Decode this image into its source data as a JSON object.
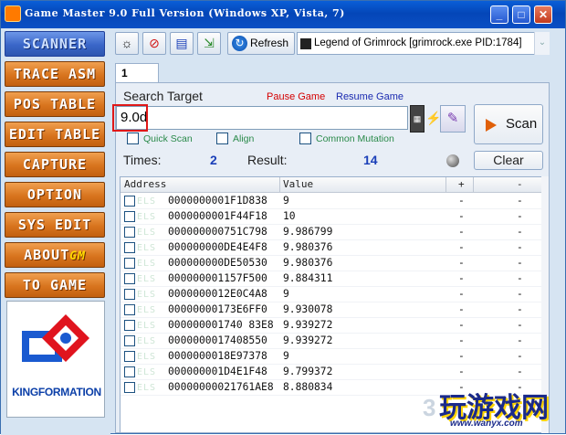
{
  "window": {
    "title": "Game Master 9.0 Full Version (Windows XP, Vista, 7)",
    "minimize": "_",
    "maximize": "□",
    "close": "✕"
  },
  "sidebar": {
    "items": [
      {
        "label": "SCANNER",
        "active": true
      },
      {
        "label": "TRACE ASM"
      },
      {
        "label": "POS TABLE"
      },
      {
        "label": "EDIT TABLE"
      },
      {
        "label": "CAPTURE"
      },
      {
        "label": "OPTION"
      },
      {
        "label": "SYS EDIT"
      },
      {
        "label": "ABOUT",
        "suffix": "GM"
      },
      {
        "label": "TO GAME"
      }
    ],
    "logo_text": "KINGFORMATION"
  },
  "toolbar": {
    "icons": [
      "sun-icon",
      "cancel-icon",
      "document-icon",
      "export-icon"
    ],
    "refresh_label": "Refresh",
    "process": "Legend of Grimrock  [grimrock.exe PID:1784]"
  },
  "tab": {
    "label": "1"
  },
  "search": {
    "label": "Search Target",
    "pause": "Pause Game",
    "resume": "Resume Game",
    "value": "9.0d",
    "scan_label": "Scan",
    "options": [
      "Quick Scan",
      "Align",
      "Common Mutation"
    ]
  },
  "stats": {
    "times_label": "Times:",
    "times_value": "2",
    "result_label": "Result:",
    "result_value": "14",
    "clear_label": "Clear"
  },
  "grid": {
    "columns": {
      "address": "Address",
      "value": "Value",
      "plus": "+",
      "minus": "-"
    },
    "rows": [
      {
        "address": "0000000001F1D838",
        "value": "9",
        "plus": "-",
        "minus": "-"
      },
      {
        "address": "0000000001F44F18",
        "value": "10",
        "plus": "-",
        "minus": "-"
      },
      {
        "address": "000000000751C798",
        "value": "9.986799",
        "plus": "-",
        "minus": "-"
      },
      {
        "address": "000000000DE4E4F8",
        "value": "9.980376",
        "plus": "-",
        "minus": "-"
      },
      {
        "address": "000000000DE50530",
        "value": "9.980376",
        "plus": "-",
        "minus": "-"
      },
      {
        "address": "000000001157F500",
        "value": "9.884311",
        "plus": "-",
        "minus": "-"
      },
      {
        "address": "0000000012E0C4A8",
        "value": "9",
        "plus": "-",
        "minus": "-"
      },
      {
        "address": "00000000173E6FF0",
        "value": "9.930078",
        "plus": "-",
        "minus": "-"
      },
      {
        "address": "000000001740 83E8",
        "value": "9.939272",
        "plus": "-",
        "minus": "-"
      },
      {
        "address": "0000000017408550",
        "value": "9.939272",
        "plus": "-",
        "minus": "-"
      },
      {
        "address": "0000000018E97378",
        "value": "9",
        "plus": "-",
        "minus": "-"
      },
      {
        "address": "000000001D4E1F48",
        "value": "9.799372",
        "plus": "-",
        "minus": "-"
      },
      {
        "address": "00000000021761AE8",
        "value": "8.880834",
        "plus": "-",
        "minus": "-"
      }
    ]
  },
  "watermark": {
    "brand": "玩游戏网",
    "url": "www.wanyx.com",
    "corner": "3"
  }
}
